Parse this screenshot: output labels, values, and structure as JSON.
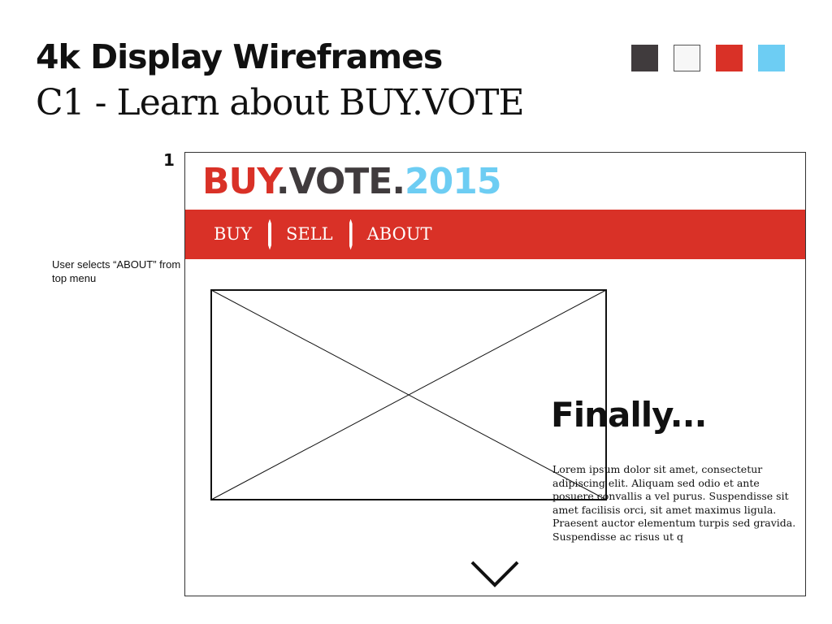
{
  "header": {
    "title": "4k Display Wireframes",
    "subtitle": "C1 - Learn about BUY.VOTE"
  },
  "palette": {
    "swatches": [
      {
        "name": "charcoal",
        "color": "#403b3d"
      },
      {
        "name": "white",
        "color": "#f7f7f7"
      },
      {
        "name": "red",
        "color": "#d93127"
      },
      {
        "name": "sky-blue",
        "color": "#6dcdf3"
      }
    ]
  },
  "step": {
    "number": "1",
    "annotation": "User selects “ABOUT” from top menu"
  },
  "wireframe": {
    "logo": {
      "part1": "BUY",
      "part1_color": "#d93127",
      "part2": ".VOTE.",
      "part2_color": "#403b3d",
      "part3": "2015",
      "part3_color": "#6dcdf3"
    },
    "nav": {
      "background": "#d93127",
      "items": [
        {
          "label": "BUY"
        },
        {
          "label": "SELL"
        },
        {
          "label": "ABOUT"
        }
      ]
    },
    "image_placeholder": "image-placeholder-icon",
    "heading": "Finally...",
    "body": "Lorem ipsum dolor sit amet, consectetur adipiscing elit. Aliquam sed odio et ante posuere convallis a vel purus. Suspendisse sit amet facilisis orci, sit amet maximus ligula. Praesent auctor elementum turpis sed gravida. Suspendisse ac risus ut q",
    "scroll_icon": "chevron-down-icon"
  }
}
